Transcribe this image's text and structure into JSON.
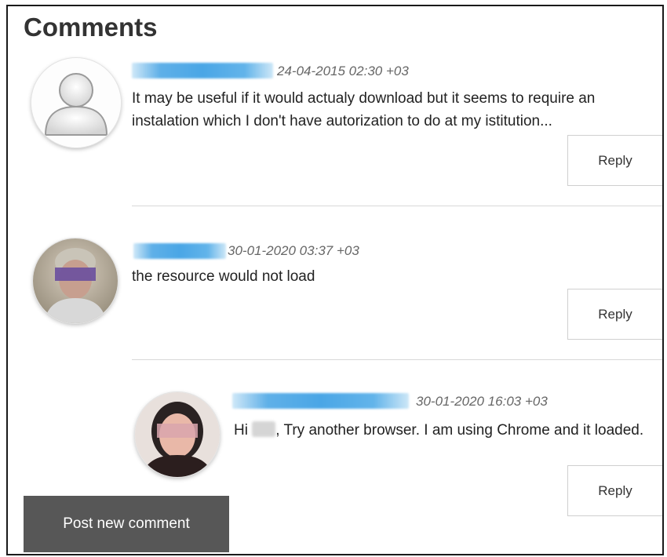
{
  "page": {
    "title": "Comments"
  },
  "comments": [
    {
      "meta": "24-04-2015 02:30 +03",
      "text": "It may be useful if it would actualy download but it seems to require an instalation which I don't have autorization to do at my istitution...",
      "reply_label": "Reply"
    },
    {
      "meta": "30-01-2020 03:37 +03",
      "text": "the resource would not load",
      "reply_label": "Reply"
    },
    {
      "meta": "30-01-2020 16:03 +03",
      "text_prefix": "Hi ",
      "text_suffix": ", Try another browser. I am using Chrome and it loaded.",
      "reply_label": "Reply"
    }
  ],
  "actions": {
    "post_label": "Post new comment"
  },
  "icons": {
    "default_avatar": "default-user-avatar-icon"
  }
}
